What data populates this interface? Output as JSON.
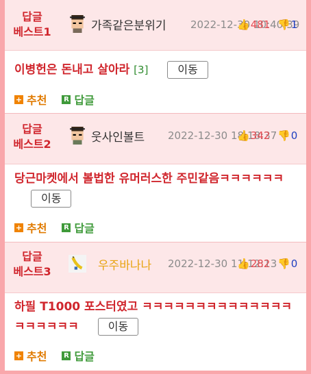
{
  "posts": [
    {
      "rank_line1": "답글",
      "rank_line2": "베스트1",
      "nickname": "가족같은분위기",
      "avatar_icon": "pixel-character-avatar-icon",
      "date": "2022-12-30 10:40:39",
      "upvotes": "481",
      "downvotes": "1",
      "title": "이병헌은 돈내고 살아라",
      "comment_count": "[3]",
      "move_label": "이동",
      "recommend_label": "추천",
      "reply_label": "답글"
    },
    {
      "rank_line1": "답글",
      "rank_line2": "베스트2",
      "nickname": "웃사인볼트",
      "avatar_icon": "pixel-character-avatar-icon",
      "date": "2022-12-30 18:18:37",
      "upvotes": "342",
      "downvotes": "0",
      "title": "당근마켓에서 볼법한 유머러스한 주민같음ㅋㅋㅋㅋㅋㅋ",
      "comment_count": "",
      "move_label": "이동",
      "recommend_label": "추천",
      "reply_label": "답글"
    },
    {
      "rank_line1": "답글",
      "rank_line2": "베스트3",
      "nickname": "우주바나나",
      "avatar_icon": "banana-avatar-icon",
      "date": "2022-12-30 11:12:13",
      "upvotes": "282",
      "downvotes": "0",
      "title": "하필 T1000 포스터였고 ㅋㅋㅋㅋㅋㅋㅋㅋㅋㅋㅋㅋㅋㅋㅋㅋㅋㅋㅋㅋ",
      "comment_count": "",
      "move_label": "이동",
      "recommend_label": "추천",
      "reply_label": "답글"
    }
  ],
  "colors": {
    "page_border": "#f9a7ab",
    "header_bg": "#fde7e8",
    "title_red": "#d0262d",
    "recommend_orange": "#e07a00",
    "reply_green": "#3f9a3a",
    "downvote_blue": "#1e3fc0"
  }
}
